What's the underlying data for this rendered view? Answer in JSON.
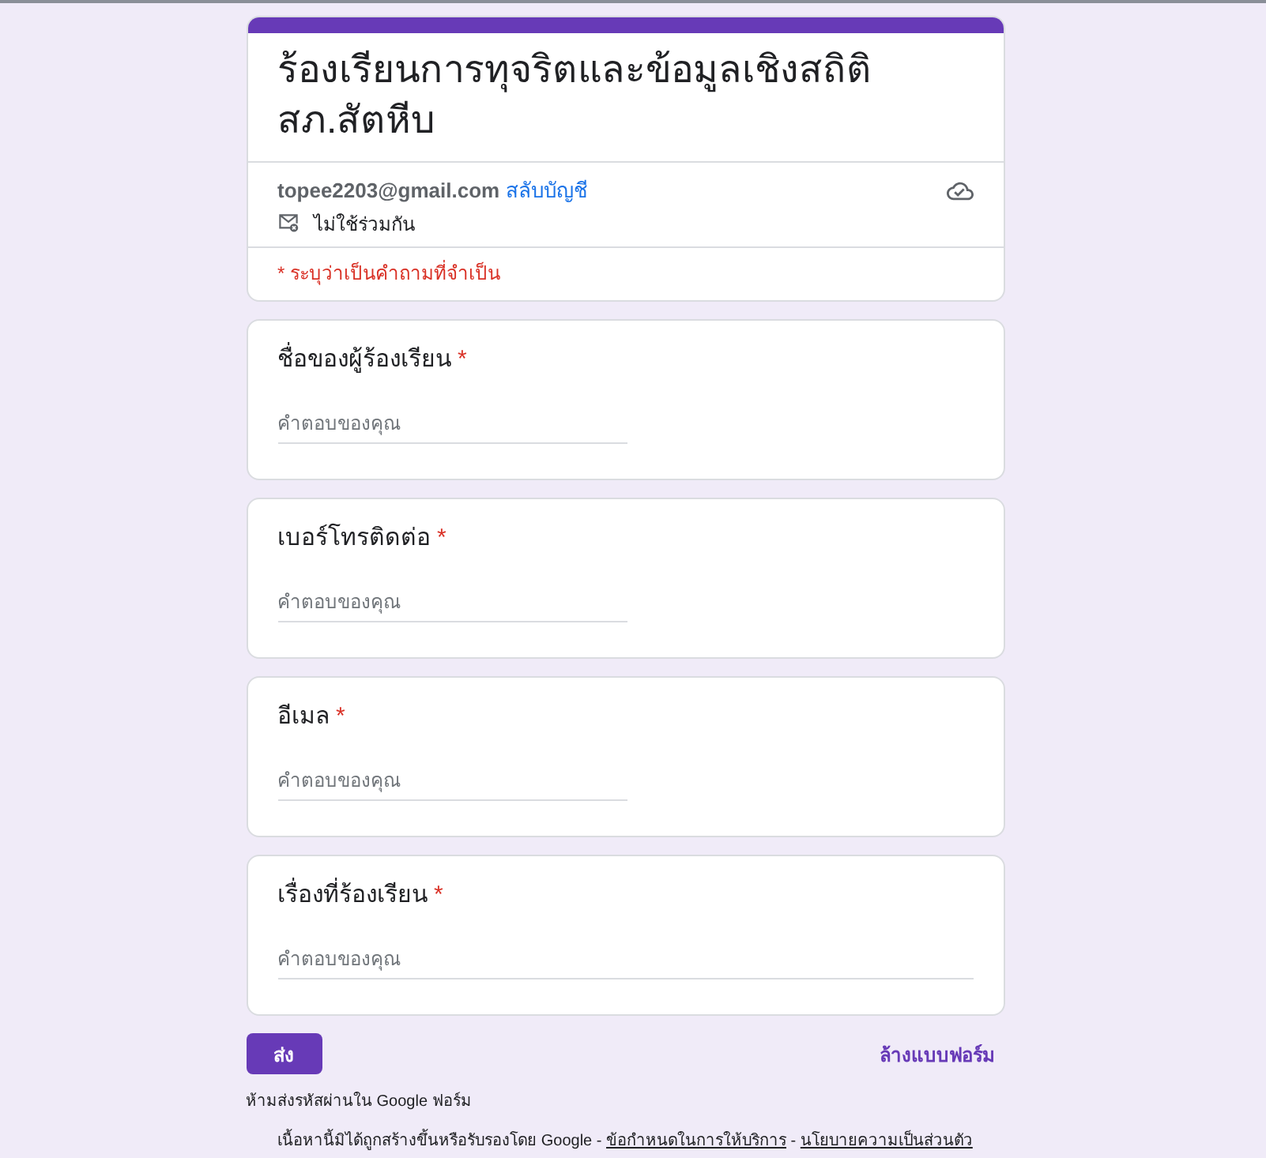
{
  "header": {
    "title": "ร้องเรียนการทุจริตและข้อมูลเชิงสถิติ สภ.สัตหีบ",
    "account_email": "topee2203@gmail.com",
    "switch_account": "สลับบัญชี",
    "sharing_status": "ไม่ใช้ร่วมกัน",
    "required_note": "* ระบุว่าเป็นคำถามที่จำเป็น"
  },
  "questions": [
    {
      "label": "ชื่อของผู้ร้องเรียน",
      "required_mark": "*",
      "kind": "short",
      "placeholder": "คำตอบของคุณ"
    },
    {
      "label": "เบอร์โทรติดต่อ",
      "required_mark": "*",
      "kind": "short",
      "placeholder": "คำตอบของคุณ"
    },
    {
      "label": "อีเมล",
      "required_mark": "*",
      "kind": "short",
      "placeholder": "คำตอบของคุณ"
    },
    {
      "label": "เรื่องที่ร้องเรียน",
      "required_mark": "*",
      "kind": "paragraph",
      "placeholder": "คำตอบของคุณ"
    }
  ],
  "actions": {
    "submit": "ส่ง",
    "clear": "ล้างแบบฟอร์ม"
  },
  "password_warning": "ห้ามส่งรหัสผ่านใน Google ฟอร์ม",
  "footer": {
    "parts": [
      {
        "kind": "text",
        "text": "เนื้อหานี้มิได้ถูกสร้างขึ้นหรือรับรองโดย Google - "
      },
      {
        "kind": "link",
        "text": "ข้อกำหนดในการให้บริการ"
      },
      {
        "kind": "text",
        "text": " - "
      },
      {
        "kind": "link",
        "text": "นโยบายความเป็นส่วนตัว"
      }
    ]
  }
}
